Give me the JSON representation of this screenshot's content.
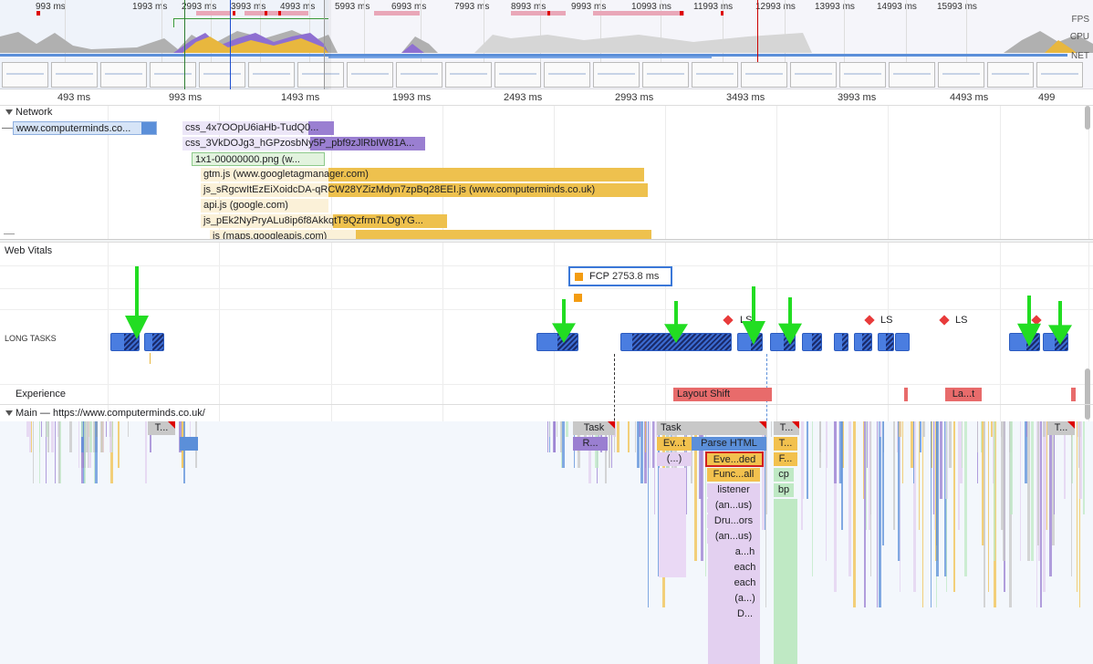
{
  "overview": {
    "ticks": [
      "993 ms",
      "1993 ms",
      "2993 ms",
      "3993 ms",
      "4993 ms",
      "5993 ms",
      "6993 ms",
      "7993 ms",
      "8993 ms",
      "9993 ms",
      "10993 ms",
      "11993 ms",
      "12993 ms",
      "13993 ms",
      "14993 ms",
      "15993 ms"
    ],
    "track_labels": {
      "fps": "FPS",
      "cpu": "CPU",
      "net": "NET"
    }
  },
  "ruler": {
    "ticks": [
      "493 ms",
      "993 ms",
      "1493 ms",
      "1993 ms",
      "2493 ms",
      "2993 ms",
      "3493 ms",
      "3993 ms",
      "4493 ms",
      "499"
    ]
  },
  "network": {
    "title": "Network",
    "requests": [
      {
        "label": "www.computerminds.co..."
      },
      {
        "label": "css_4x7OOpU6iaHb-TudQ0..."
      },
      {
        "label": "css_3VkDOJg3_hGPzosbNy5P_pbf9zJlRbIW81A..."
      },
      {
        "label": "1x1-00000000.png (w..."
      },
      {
        "label": "gtm.js (www.googletagmanager.com)"
      },
      {
        "label": "js_sRgcwItEzEiXoidcDA-qRCW28YZizMdyn7zpBq28EEI.js (www.computerminds.co.uk)"
      },
      {
        "label": "api.js (google.com)"
      },
      {
        "label": "js_pEk2NyPryALu8ip6f8AkkqtT9Qzfrm7LOgYG..."
      },
      {
        "label": "js (maps.googleapis.com)"
      }
    ]
  },
  "web_vitals": {
    "title": "Web Vitals",
    "fcp": {
      "label": "FCP",
      "value": "2753.8 ms"
    },
    "ls_label": "LS",
    "long_tasks_label": "LONG TASKS"
  },
  "experience": {
    "title": "Experience",
    "layout_shift": "Layout Shift",
    "layout_shift_short": "La...t"
  },
  "main": {
    "title": "Main — https://www.computerminds.co.uk/",
    "flames": {
      "task": "Task",
      "t_short": "T...",
      "t_dot": "T...",
      "r": "R...",
      "ev_t": "Ev...t",
      "parse_html": "Parse HTML",
      "anon": "(...)",
      "eve_ded": "Eve...ded",
      "func_all": "Func...all",
      "listener": "listener",
      "an_us": "(an...us)",
      "dru_ors": "Dru...ors",
      "an_us2": "(an...us)",
      "a_h": "a...h",
      "each1": "each",
      "each2": "each",
      "a_ellipsis": "(a...)",
      "d_ellipsis": "D...",
      "f_ellipsis": "F...",
      "cp": "cp",
      "bp": "bp"
    }
  },
  "colors": {
    "scripting": "#f2c14e",
    "rendering": "#9a7fd1",
    "loading": "#5b8fd9",
    "painting": "#6fcf7a",
    "long_task": "#4a7de0",
    "layout_shift": "#e86b6b",
    "arrow": "#22dd22"
  }
}
